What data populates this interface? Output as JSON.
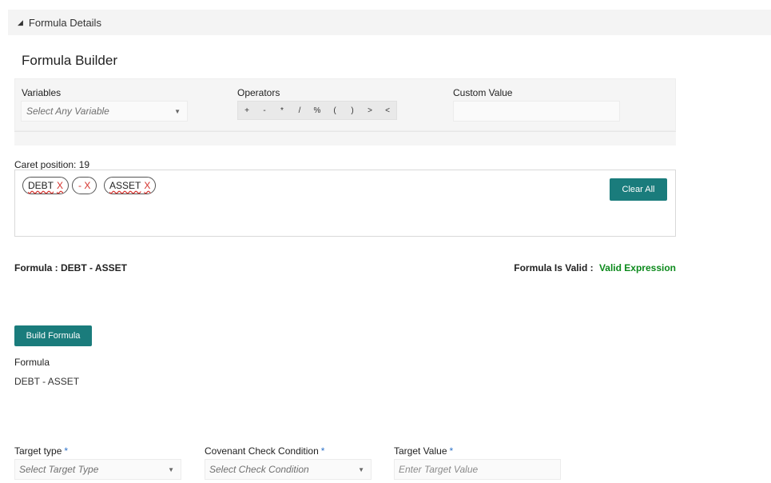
{
  "section": {
    "title": "Formula Details"
  },
  "page_title": "Formula Builder",
  "variables": {
    "label": "Variables",
    "placeholder": "Select Any Variable"
  },
  "operators": {
    "label": "Operators",
    "items": [
      "+",
      "-",
      "*",
      "/",
      "%",
      "(",
      ")",
      ">",
      "<"
    ]
  },
  "custom_value": {
    "label": "Custom Value",
    "value": ""
  },
  "caret": {
    "label": "Caret position: 19"
  },
  "tokens": [
    {
      "text": "DEBT",
      "remove": "X"
    },
    {
      "text": "- X",
      "remove": ""
    },
    {
      "text": "ASSET",
      "remove": "X"
    }
  ],
  "clear_all_label": "Clear All",
  "formula_summary": {
    "label": "Formula :",
    "value": "DEBT - ASSET"
  },
  "validity": {
    "label": "Formula Is Valid :",
    "value": "Valid Expression",
    "color": "#0c8a1c"
  },
  "build_formula_label": "Build Formula",
  "formula_result": {
    "label": "Formula",
    "value": "DEBT - ASSET"
  },
  "target_type": {
    "label": "Target type",
    "required": "*",
    "placeholder": "Select Target Type"
  },
  "check_condition": {
    "label": "Covenant Check Condition",
    "required": "*",
    "placeholder": "Select Check Condition"
  },
  "target_value": {
    "label": "Target Value",
    "required": "*",
    "placeholder": "Enter Target Value"
  },
  "colors": {
    "accent": "#1a7c7c",
    "error": "#d4302b",
    "required": "#2e73c9"
  },
  "icons": {
    "section_toggle": "collapse-triangle-icon",
    "dropdown": "chevron-down-icon"
  }
}
